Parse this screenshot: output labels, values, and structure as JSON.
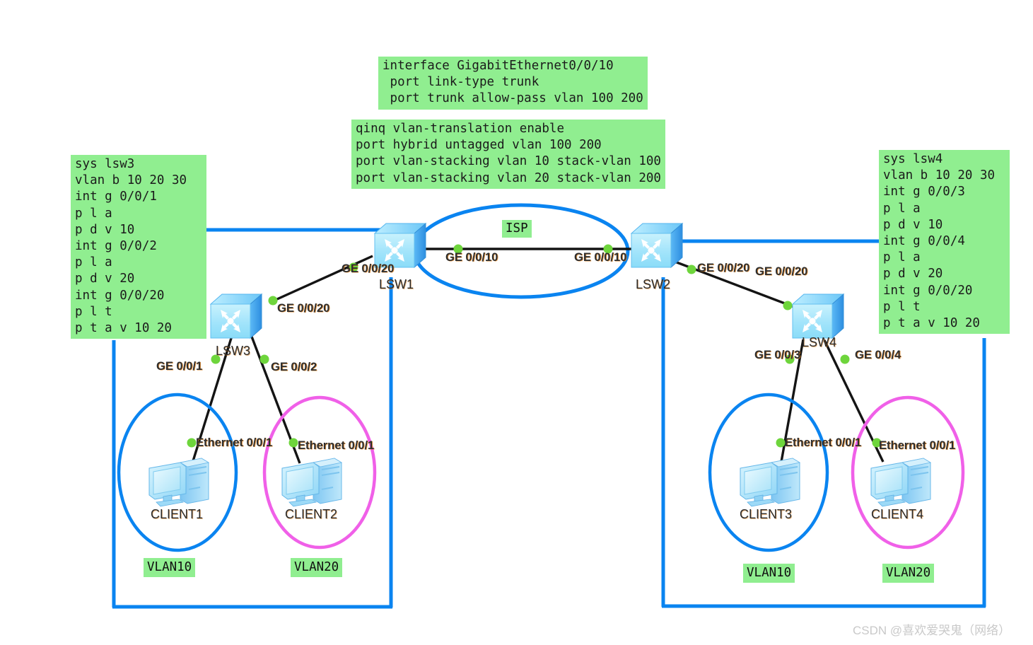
{
  "diagram": {
    "title": "QinQ VLAN stacking topology",
    "colors": {
      "vlan_blue": "#0a84f0",
      "vlan_magenta": "#f060e8",
      "config_green": "#90ee90",
      "link_black": "#141414",
      "port_dot_green": "#6ed53c",
      "switch_face": "#a8e8fb",
      "switch_side": "#3fa9f5"
    }
  },
  "config_boxes": {
    "lsw1_trunk": {
      "text": "interface GigabitEthernet0/0/10\n port link-type trunk\n port trunk allow-pass vlan 100 200"
    },
    "qinq": {
      "text": "qinq vlan-translation enable\nport hybrid untagged vlan 100 200\nport vlan-stacking vlan 10 stack-vlan 100\nport vlan-stacking vlan 20 stack-vlan 200"
    },
    "lsw3": {
      "text": "sys lsw3\nvlan b 10 20 30\nint g 0/0/1\np l a\np d v 10\nint g 0/0/2\np l a\np d v 20\nint g 0/0/20\np l t\np t a v 10 20"
    },
    "lsw4": {
      "text": "sys lsw4\nvlan b 10 20 30\nint g 0/0/3\np l a\np d v 10\nint g 0/0/4\np l a\np d v 20\nint g 0/0/20\np l t\np t a v 10 20"
    }
  },
  "cloud": {
    "label": "ISP"
  },
  "devices": [
    {
      "id": "lsw1",
      "label": "LSW1",
      "type": "switch"
    },
    {
      "id": "lsw2",
      "label": "LSW2",
      "type": "switch"
    },
    {
      "id": "lsw3",
      "label": "LSW3",
      "type": "switch"
    },
    {
      "id": "lsw4",
      "label": "LSW4",
      "type": "switch"
    },
    {
      "id": "client1",
      "label": "CLIENT1",
      "type": "pc"
    },
    {
      "id": "client2",
      "label": "CLIENT2",
      "type": "pc"
    },
    {
      "id": "client3",
      "label": "CLIENT3",
      "type": "pc"
    },
    {
      "id": "client4",
      "label": "CLIENT4",
      "type": "pc"
    }
  ],
  "interfaces": {
    "lsw1_to_lsw2": "GE 0/0/10",
    "lsw2_to_lsw1": "GE 0/0/10",
    "lsw1_to_lsw3": "GE 0/0/20",
    "lsw3_to_lsw1": "GE 0/0/20",
    "lsw2_to_lsw4": "GE 0/0/20",
    "lsw4_to_lsw2": "GE 0/0/20",
    "lsw3_to_client1": "GE 0/0/1",
    "lsw3_to_client2": "GE 0/0/2",
    "lsw4_to_client3": "GE 0/0/3",
    "lsw4_to_client4": "GE 0/0/4",
    "client1_nic": "Ethernet 0/0/1",
    "client2_nic": "Ethernet 0/0/1",
    "client3_nic": "Ethernet 0/0/1",
    "client4_nic": "Ethernet 0/0/1"
  },
  "vlan_tags": {
    "left_vlan10": "VLAN10",
    "left_vlan20": "VLAN20",
    "right_vlan10": "VLAN10",
    "right_vlan20": "VLAN20"
  },
  "watermark": {
    "text": "CSDN @喜欢爱哭鬼（网络）"
  }
}
